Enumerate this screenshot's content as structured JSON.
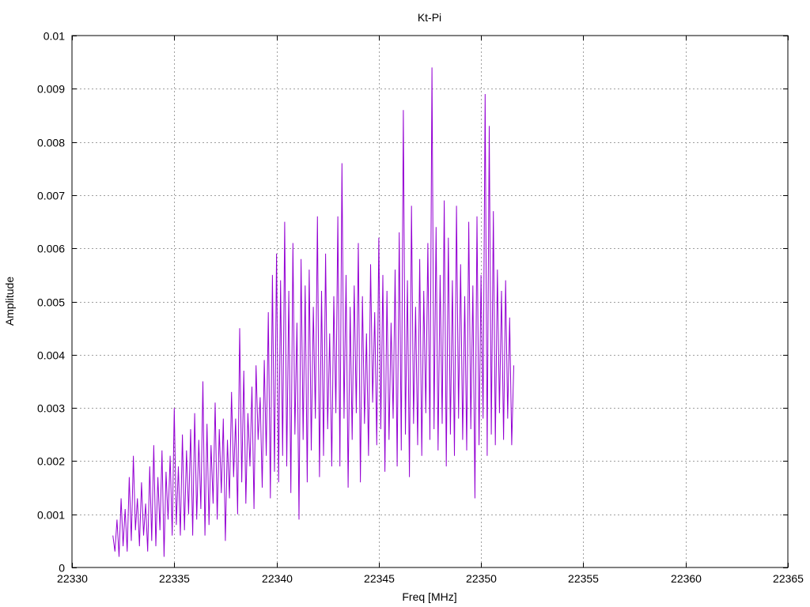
{
  "chart_data": {
    "type": "line",
    "title": "Kt-Pi",
    "xlabel": "Freq [MHz]",
    "ylabel": "Amplitude",
    "xlim": [
      22330,
      22365
    ],
    "ylim": [
      0,
      0.01
    ],
    "grid": true,
    "x_ticks": [
      "22330",
      "22335",
      "22340",
      "22345",
      "22350",
      "22355",
      "22360",
      "22365"
    ],
    "y_ticks": [
      "0",
      "0.001",
      "0.002",
      "0.003",
      "0.004",
      "0.005",
      "0.006",
      "0.007",
      "0.008",
      "0.009",
      "0.01"
    ],
    "series": [
      {
        "color": "#9400d3",
        "x_start": 22332.0,
        "x_step": 0.1,
        "values": [
          0.0006,
          0.0003,
          0.0009,
          0.0002,
          0.0013,
          0.0004,
          0.0011,
          0.0003,
          0.0017,
          0.0005,
          0.0021,
          0.0007,
          0.0013,
          0.0004,
          0.0016,
          0.0006,
          0.0012,
          0.0003,
          0.0019,
          0.0005,
          0.0023,
          0.0004,
          0.0017,
          0.0007,
          0.0022,
          0.0002,
          0.0018,
          0.0009,
          0.0021,
          0.0006,
          0.003,
          0.0008,
          0.0019,
          0.0006,
          0.0025,
          0.0007,
          0.0022,
          0.001,
          0.0026,
          0.0006,
          0.0029,
          0.0009,
          0.0024,
          0.0011,
          0.0035,
          0.0006,
          0.0027,
          0.0008,
          0.0023,
          0.0012,
          0.0031,
          0.0009,
          0.0026,
          0.0014,
          0.0028,
          0.0005,
          0.0024,
          0.0013,
          0.0033,
          0.0017,
          0.0028,
          0.001,
          0.0045,
          0.0016,
          0.0037,
          0.0012,
          0.0029,
          0.0019,
          0.0034,
          0.0011,
          0.0038,
          0.0024,
          0.0032,
          0.0015,
          0.0039,
          0.0021,
          0.0048,
          0.0013,
          0.0055,
          0.0018,
          0.0059,
          0.0016,
          0.0054,
          0.0021,
          0.0065,
          0.0019,
          0.0052,
          0.0014,
          0.0061,
          0.0025,
          0.0046,
          0.0009,
          0.0058,
          0.0024,
          0.0053,
          0.0016,
          0.0056,
          0.0022,
          0.0049,
          0.0028,
          0.0066,
          0.0017,
          0.0052,
          0.0021,
          0.0059,
          0.0026,
          0.0044,
          0.0019,
          0.0051,
          0.0029,
          0.0066,
          0.0019,
          0.0076,
          0.0028,
          0.0055,
          0.0015,
          0.0049,
          0.0024,
          0.0053,
          0.0029,
          0.0061,
          0.0016,
          0.0051,
          0.0027,
          0.0044,
          0.0021,
          0.0057,
          0.0031,
          0.0048,
          0.0023,
          0.0062,
          0.0026,
          0.0055,
          0.0018,
          0.0052,
          0.0024,
          0.0046,
          0.0028,
          0.0056,
          0.0019,
          0.0063,
          0.0022,
          0.0086,
          0.0025,
          0.0054,
          0.0017,
          0.0068,
          0.0027,
          0.0049,
          0.0023,
          0.0058,
          0.0021,
          0.0052,
          0.0029,
          0.0061,
          0.0024,
          0.0094,
          0.0026,
          0.0064,
          0.0022,
          0.0055,
          0.0027,
          0.0069,
          0.0019,
          0.0062,
          0.0025,
          0.0054,
          0.0021,
          0.0068,
          0.0028,
          0.0057,
          0.0024,
          0.0051,
          0.0022,
          0.0065,
          0.0026,
          0.0053,
          0.0013,
          0.0066,
          0.0023,
          0.0055,
          0.0028,
          0.0089,
          0.0021,
          0.0083,
          0.0025,
          0.0067,
          0.0023,
          0.0056,
          0.0029,
          0.0052,
          0.0024,
          0.0054,
          0.0028,
          0.0047,
          0.0023,
          0.0038
        ]
      }
    ]
  }
}
